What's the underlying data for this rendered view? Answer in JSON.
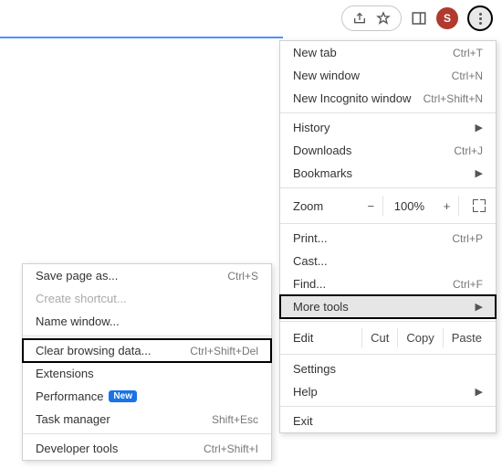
{
  "toolbar": {
    "avatar_initial": "S"
  },
  "menu": {
    "new_tab": {
      "label": "New tab",
      "shortcut": "Ctrl+T"
    },
    "new_window": {
      "label": "New window",
      "shortcut": "Ctrl+N"
    },
    "new_incognito": {
      "label": "New Incognito window",
      "shortcut": "Ctrl+Shift+N"
    },
    "history": {
      "label": "History"
    },
    "downloads": {
      "label": "Downloads",
      "shortcut": "Ctrl+J"
    },
    "bookmarks": {
      "label": "Bookmarks"
    },
    "zoom": {
      "label": "Zoom",
      "minus": "−",
      "pct": "100%",
      "plus": "+"
    },
    "print": {
      "label": "Print...",
      "shortcut": "Ctrl+P"
    },
    "cast": {
      "label": "Cast..."
    },
    "find": {
      "label": "Find...",
      "shortcut": "Ctrl+F"
    },
    "more_tools": {
      "label": "More tools"
    },
    "edit": {
      "label": "Edit",
      "cut": "Cut",
      "copy": "Copy",
      "paste": "Paste"
    },
    "settings": {
      "label": "Settings"
    },
    "help": {
      "label": "Help"
    },
    "exit": {
      "label": "Exit"
    }
  },
  "submenu": {
    "save_page": {
      "label": "Save page as...",
      "shortcut": "Ctrl+S"
    },
    "create_shortcut": {
      "label": "Create shortcut..."
    },
    "name_window": {
      "label": "Name window..."
    },
    "clear_browsing": {
      "label": "Clear browsing data...",
      "shortcut": "Ctrl+Shift+Del"
    },
    "extensions": {
      "label": "Extensions"
    },
    "performance": {
      "label": "Performance",
      "badge": "New"
    },
    "task_manager": {
      "label": "Task manager",
      "shortcut": "Shift+Esc"
    },
    "dev_tools": {
      "label": "Developer tools",
      "shortcut": "Ctrl+Shift+I"
    }
  }
}
